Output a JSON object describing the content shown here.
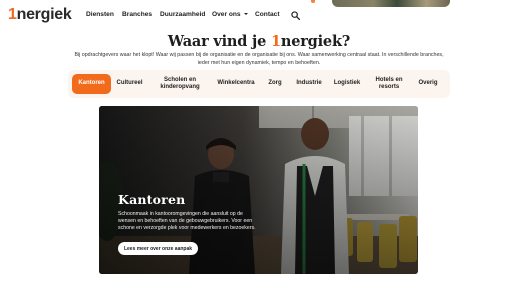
{
  "header": {
    "logo_one": "1",
    "logo_rest": "nergiek",
    "nav": {
      "diensten": "Diensten",
      "branches": "Branches",
      "duurzaamheid": "Duurzaamheid",
      "over_ons": "Over ons",
      "contact": "Contact"
    },
    "search_icon": "search-icon"
  },
  "page": {
    "title_before": "Waar vind je ",
    "title_one": "1",
    "title_after": "nergiek?",
    "intro": "Bij opdrachtgevers waar het klopt! Waar wij passen bij de organisatie en de organisatie bij ons. Waar samenwerking centraal staat. In verschillende branches, ieder met hun eigen dynamiek, tempo en behoeften."
  },
  "tabs": [
    {
      "label": "Kantoren",
      "active": true
    },
    {
      "label": "Cultureel",
      "active": false
    },
    {
      "label": "Scholen en kinderopvang",
      "active": false
    },
    {
      "label": "Winkelcentra",
      "active": false
    },
    {
      "label": "Zorg",
      "active": false
    },
    {
      "label": "Industrie",
      "active": false
    },
    {
      "label": "Logistiek",
      "active": false
    },
    {
      "label": "Hotels en resorts",
      "active": false
    },
    {
      "label": "Overig",
      "active": false
    }
  ],
  "hero": {
    "title": "Kantoren",
    "text": "Schoonmaak in kantooromgevingen die aansluit op de wensen en behoeften van de gebouwgebruikers. Voor een schone en verzorgde plek voor medewerkers en bezoekers.",
    "button": "Lees meer over onze aanpak"
  },
  "colors": {
    "accent": "#f26a1b",
    "tabs_bg": "#fbf4ef",
    "text": "#1e1e1e"
  }
}
